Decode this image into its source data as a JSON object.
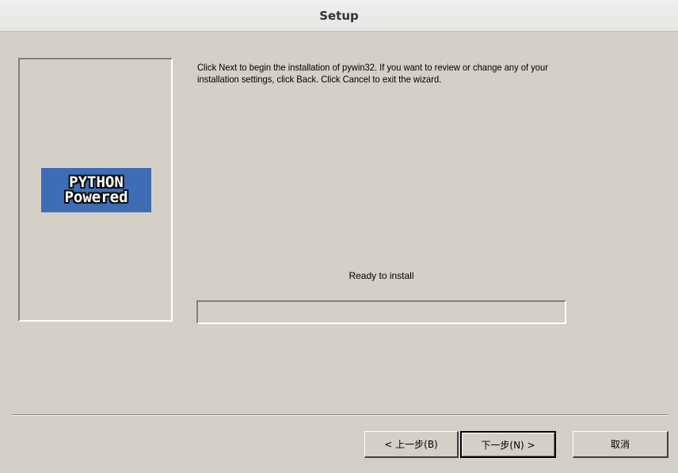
{
  "window": {
    "title": "Setup"
  },
  "banner": {
    "logo_line1": "PYTHON",
    "logo_line2": "Powered"
  },
  "main": {
    "instructions": "Click Next to begin the installation of pywin32. If you want to review or change any of your  installation settings, click Back. Click Cancel to exit the wizard.",
    "status": "Ready to install",
    "progress": 0
  },
  "buttons": {
    "back_label": "< 上一步(B)",
    "next_label": "下一步(N) >",
    "cancel_label": "取消"
  }
}
